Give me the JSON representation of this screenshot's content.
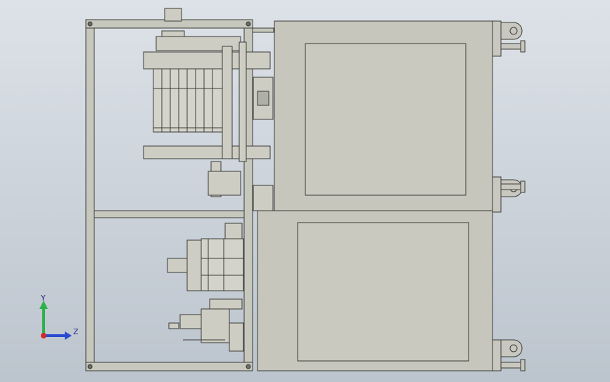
{
  "view": {
    "background_top": "#dde2e8",
    "background_bottom": "#bcc4cd",
    "frame_color": "#bfc2b6",
    "panel_color": "#c6c6bc",
    "edge_color": "#3b3b36"
  },
  "triad": {
    "y_label": "Y",
    "z_label": "Z",
    "y_color": "#2bb24c",
    "z_color": "#2a4bd1",
    "x_color": "#d12a2a"
  }
}
